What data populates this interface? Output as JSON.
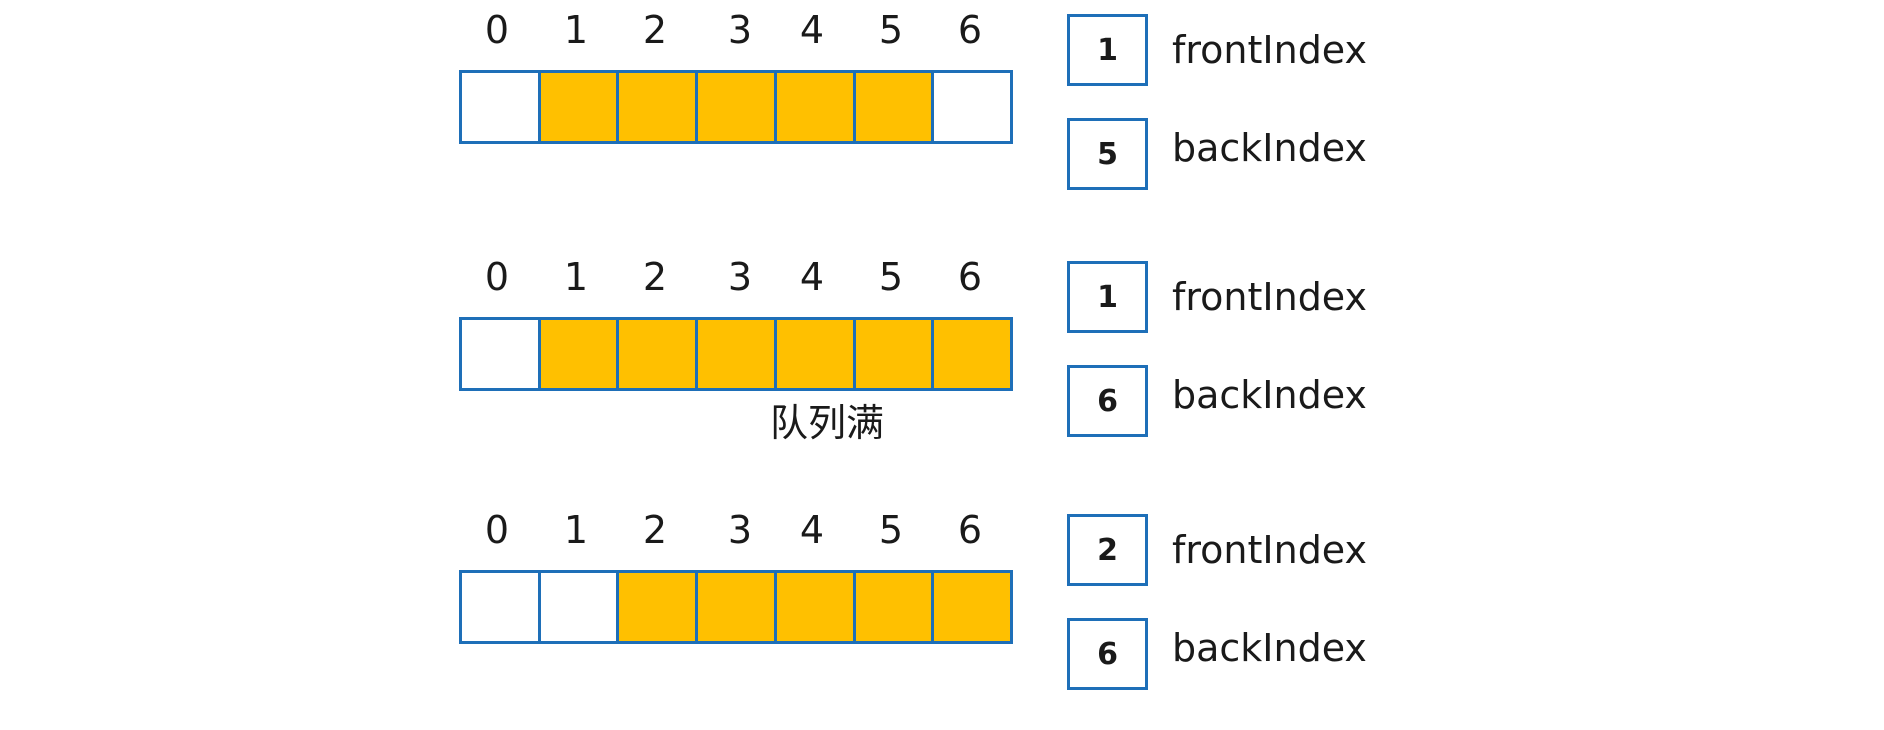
{
  "indices": [
    "0",
    "1",
    "2",
    "3",
    "4",
    "5",
    "6"
  ],
  "states": [
    {
      "filled": [
        false,
        true,
        true,
        true,
        true,
        true,
        false
      ],
      "front_value": "1",
      "front_label": "frontIndex",
      "back_value": "5",
      "back_label": "backIndex",
      "caption": ""
    },
    {
      "filled": [
        false,
        true,
        true,
        true,
        true,
        true,
        true
      ],
      "front_value": "1",
      "front_label": "frontIndex",
      "back_value": "6",
      "back_label": "backIndex",
      "caption": "队列满"
    },
    {
      "filled": [
        false,
        false,
        true,
        true,
        true,
        true,
        true
      ],
      "front_value": "2",
      "front_label": "frontIndex",
      "back_value": "6",
      "back_label": "backIndex",
      "caption": ""
    }
  ],
  "colors": {
    "filled_cell": "#ffc000",
    "empty_cell": "#ffffff",
    "border": "#1e6fb8"
  }
}
